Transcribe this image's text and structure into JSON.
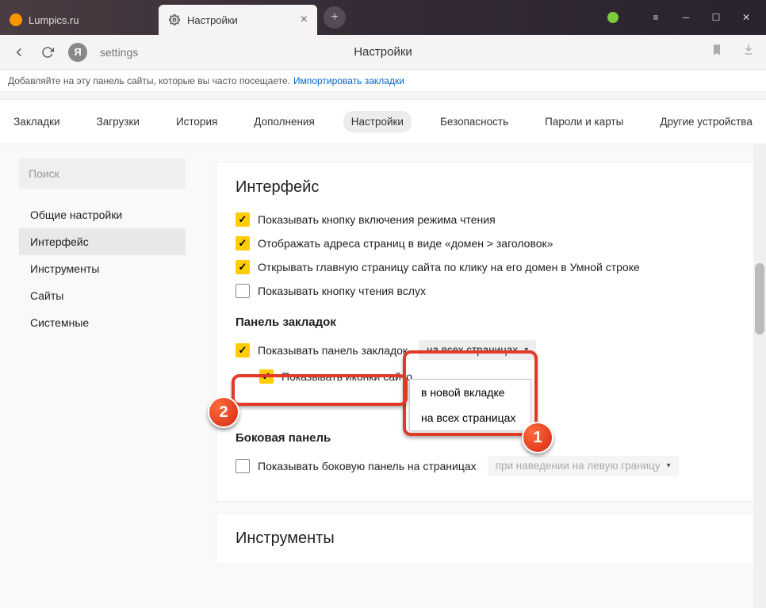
{
  "tabs": [
    {
      "label": "Lumpics.ru"
    },
    {
      "label": "Настройки"
    }
  ],
  "addressbar": {
    "icon_letter": "Я",
    "text": "settings",
    "page_title": "Настройки"
  },
  "bookmarkbar": {
    "hint": "Добавляйте на эту панель сайты, которые вы часто посещаете.",
    "import_link": "Импортировать закладки"
  },
  "topnav": [
    "Закладки",
    "Загрузки",
    "История",
    "Дополнения",
    "Настройки",
    "Безопасность",
    "Пароли и карты",
    "Другие устройства"
  ],
  "sidebar": {
    "search_placeholder": "Поиск",
    "items": [
      "Общие настройки",
      "Интерфейс",
      "Инструменты",
      "Сайты",
      "Системные"
    ]
  },
  "sections": {
    "interface": {
      "title": "Интерфейс",
      "checks": [
        "Показывать кнопку включения режима чтения",
        "Отображать адреса страниц в виде «домен > заголовок»",
        "Открывать главную страницу сайта по клику на его домен в Умной строке",
        "Показывать кнопку чтения вслух"
      ]
    },
    "bookmarks_panel": {
      "title": "Панель закладок",
      "show_panel": "Показывать панель закладок",
      "dropdown_selected": "на всех страницах",
      "dropdown_options": [
        "в новой вкладке",
        "на всех страницах"
      ],
      "show_icons": "Показывать иконки сайто"
    },
    "side_panel": {
      "title": "Боковая панель",
      "show_side": "Показывать боковую панель на страницах",
      "dropdown_disabled": "при наведении на левую границу"
    },
    "tools": {
      "title": "Инструменты"
    }
  },
  "annotations": {
    "badge1": "1",
    "badge2": "2"
  }
}
